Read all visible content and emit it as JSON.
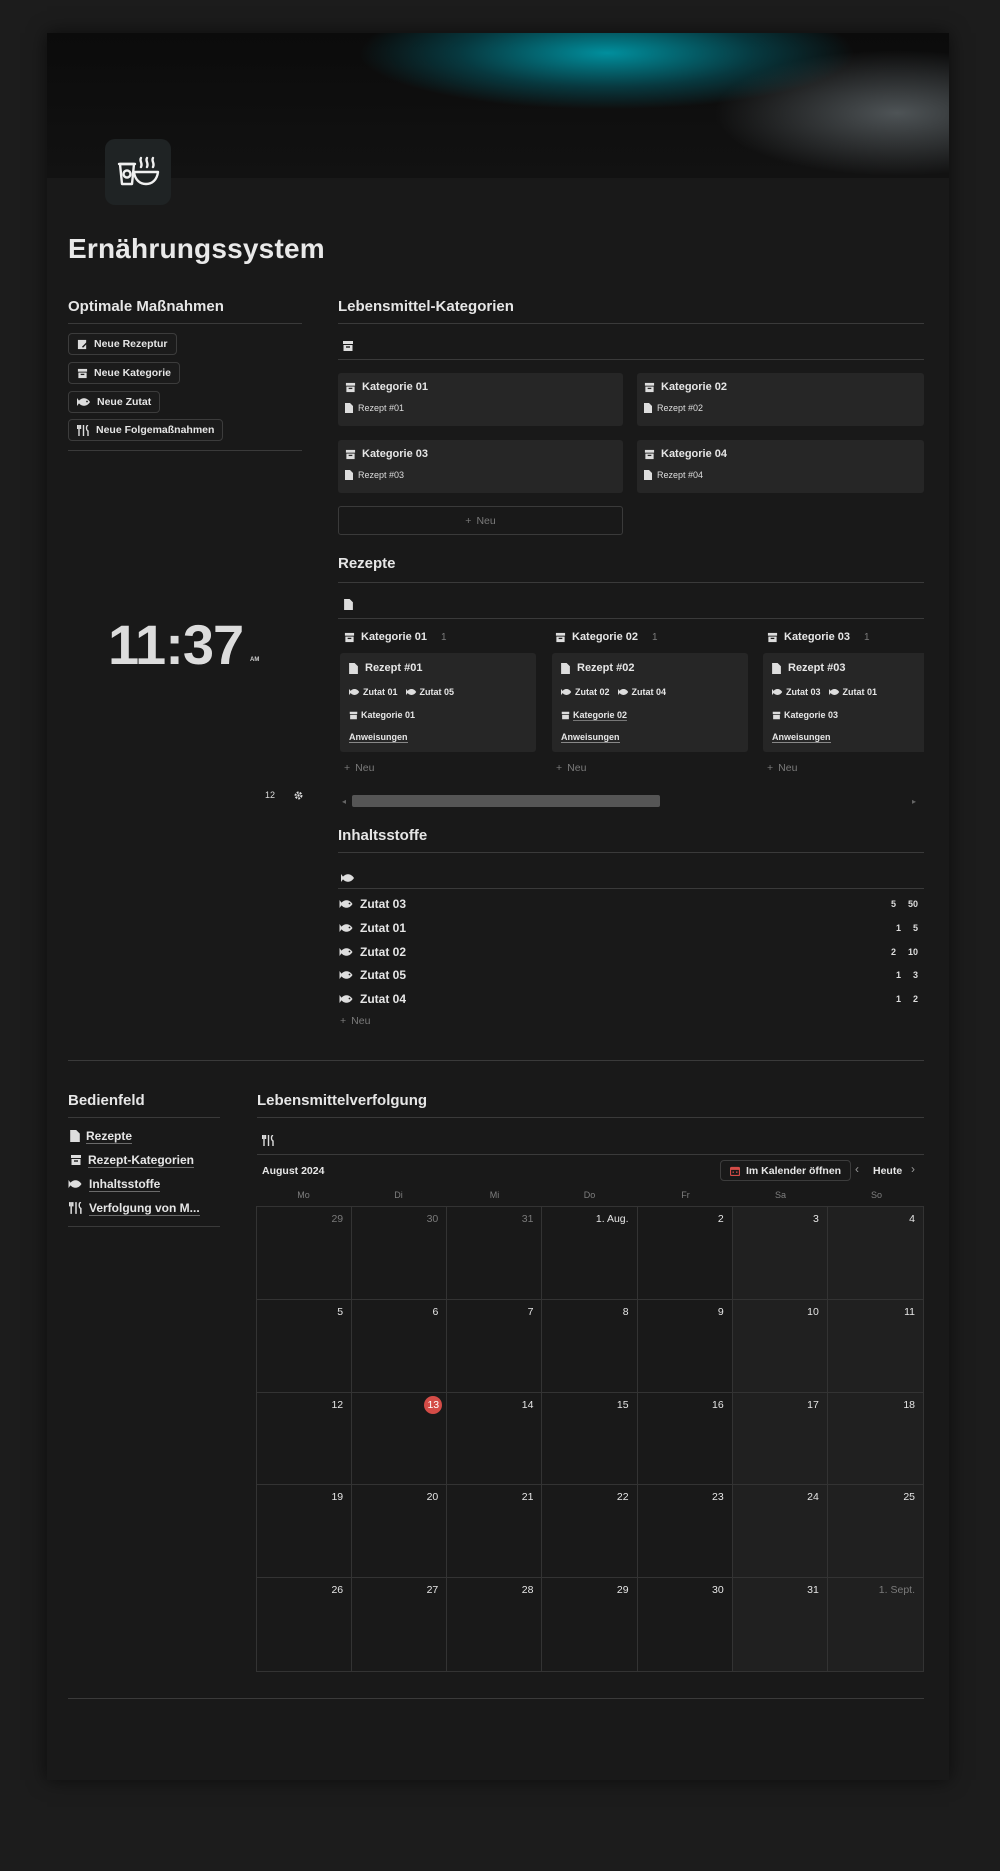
{
  "page": {
    "title": "Ernährungssystem"
  },
  "actions": {
    "heading": "Optimale Maßnahmen",
    "buttons": [
      "Neue Rezeptur",
      "Neue Kategorie",
      "Neue Zutat",
      "Neue Folgemaßnahmen"
    ]
  },
  "clock": {
    "time": "11:37",
    "ampm": "AM",
    "format": "12"
  },
  "categories": {
    "heading": "Lebensmittel-Kategorien",
    "new_label": "Neu",
    "cards": [
      {
        "title": "Kategorie 01",
        "recipe": "Rezept #01"
      },
      {
        "title": "Kategorie 02",
        "recipe": "Rezept #02"
      },
      {
        "title": "Kategorie 03",
        "recipe": "Rezept #03"
      },
      {
        "title": "Kategorie 04",
        "recipe": "Rezept #04"
      }
    ]
  },
  "recipes": {
    "heading": "Rezepte",
    "new_label": "Neu",
    "columns": [
      {
        "group": "Kategorie 01",
        "count": "1",
        "title": "Rezept #01",
        "ingredients": [
          "Zutat 01",
          "Zutat 05"
        ],
        "category": "Kategorie 01",
        "link": "Anweisungen"
      },
      {
        "group": "Kategorie 02",
        "count": "1",
        "title": "Rezept #02",
        "ingredients": [
          "Zutat 02",
          "Zutat 04"
        ],
        "category": "Kategorie 02",
        "link": "Anweisungen"
      },
      {
        "group": "Kategorie 03",
        "count": "1",
        "title": "Rezept #03",
        "ingredients": [
          "Zutat 03",
          "Zutat 01"
        ],
        "category": "Kategorie 03",
        "link": "Anweisungen"
      }
    ]
  },
  "ingredients": {
    "heading": "Inhaltsstoffe",
    "new_label": "Neu",
    "rows": [
      {
        "name": "Zutat 03",
        "a": "5",
        "b": "50"
      },
      {
        "name": "Zutat 01",
        "a": "1",
        "b": "5"
      },
      {
        "name": "Zutat 02",
        "a": "2",
        "b": "10"
      },
      {
        "name": "Zutat 05",
        "a": "1",
        "b": "3"
      },
      {
        "name": "Zutat 04",
        "a": "1",
        "b": "2"
      }
    ]
  },
  "panel": {
    "heading": "Bedienfeld",
    "links": [
      "Rezepte",
      "Rezept-Kategorien",
      "Inhaltsstoffe",
      "Verfolgung von M..."
    ]
  },
  "tracking": {
    "heading": "Lebensmittelverfolgung",
    "month": "August 2024",
    "open_calendar": "Im Kalender öffnen",
    "today": "Heute",
    "weekdays": [
      "Mo",
      "Di",
      "Mi",
      "Do",
      "Fr",
      "Sa",
      "So"
    ],
    "days": [
      "29",
      "30",
      "31",
      "1. Aug.",
      "2",
      "3",
      "4",
      "5",
      "6",
      "7",
      "8",
      "9",
      "10",
      "11",
      "12",
      "13",
      "14",
      "15",
      "16",
      "17",
      "18",
      "19",
      "20",
      "21",
      "22",
      "23",
      "24",
      "25",
      "26",
      "27",
      "28",
      "29",
      "30",
      "31",
      "1. Sept."
    ],
    "today_day": "13"
  },
  "colors": {
    "accent_today": "#d44c47",
    "cover_teal": "#0096a5",
    "background": "#191919"
  }
}
